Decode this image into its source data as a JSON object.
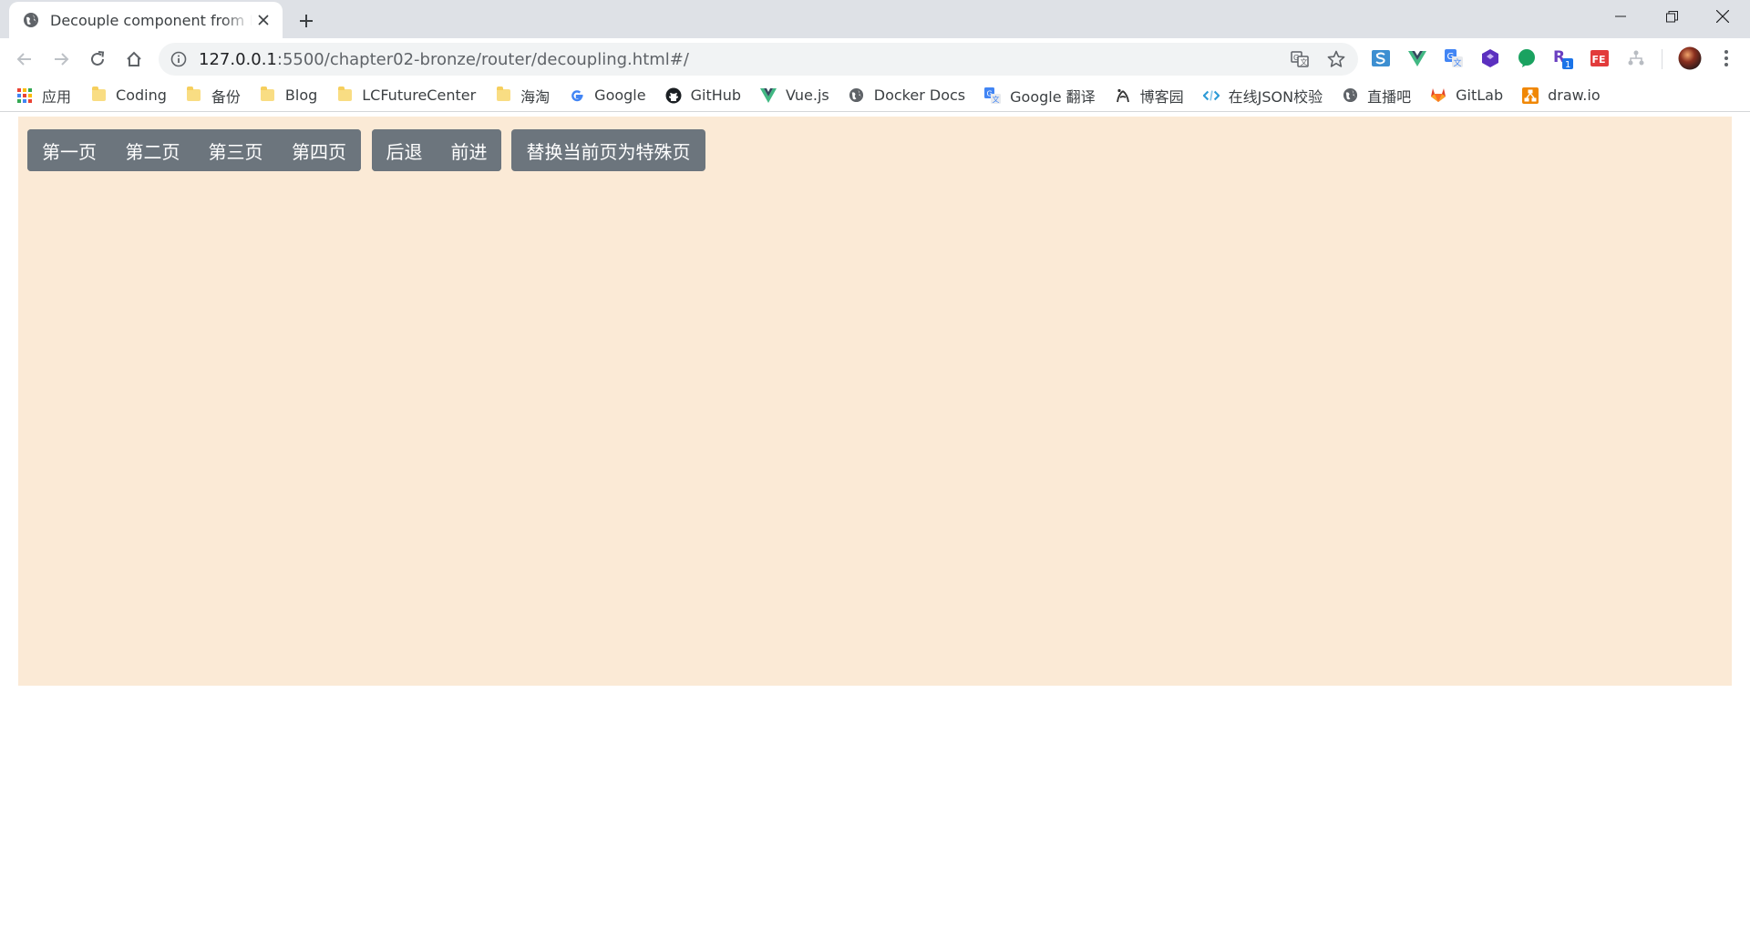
{
  "browser": {
    "tab": {
      "title": "Decouple component from Router"
    },
    "address": {
      "host": "127.0.0.1",
      "path": ":5500/chapter02-bronze/router/decoupling.html#/"
    },
    "bookmarks": [
      {
        "label": "应用",
        "icon": "apps-grid-icon"
      },
      {
        "label": "Coding",
        "icon": "folder-icon"
      },
      {
        "label": "备份",
        "icon": "folder-icon"
      },
      {
        "label": "Blog",
        "icon": "folder-icon"
      },
      {
        "label": "LCFutureCenter",
        "icon": "folder-icon"
      },
      {
        "label": "海淘",
        "icon": "folder-icon"
      },
      {
        "label": "Google",
        "icon": "google-icon"
      },
      {
        "label": "GitHub",
        "icon": "github-icon"
      },
      {
        "label": "Vue.js",
        "icon": "vue-icon"
      },
      {
        "label": "Docker Docs",
        "icon": "globe-icon"
      },
      {
        "label": "Google 翻译",
        "icon": "google-translate-icon"
      },
      {
        "label": "博客园",
        "icon": "cnblogs-icon"
      },
      {
        "label": "在线JSON校验",
        "icon": "code-icon"
      },
      {
        "label": "直播吧",
        "icon": "globe-icon"
      },
      {
        "label": "GitLab",
        "icon": "gitlab-icon"
      },
      {
        "label": "draw.io",
        "icon": "drawio-icon"
      }
    ],
    "colors": {
      "tabstrip": "#dee1e6",
      "omnibox": "#f1f3f4"
    }
  },
  "page": {
    "nav_group": [
      "第一页",
      "第二页",
      "第三页",
      "第四页"
    ],
    "history_group": [
      "后退",
      "前进"
    ],
    "replace_button": "替换当前页为特殊页",
    "colors": {
      "background": "#fbead6",
      "button": "#6c757d"
    }
  }
}
